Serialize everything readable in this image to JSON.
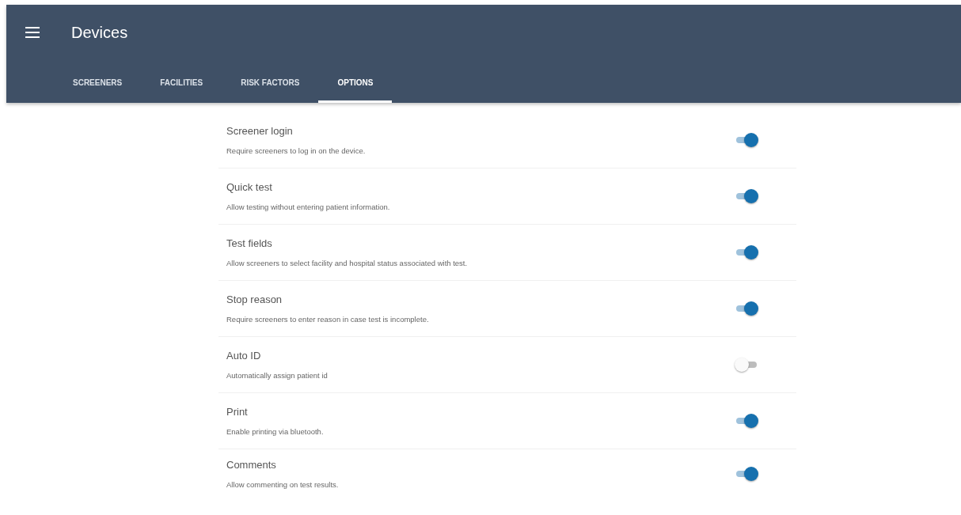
{
  "app_bar": {
    "title": "Devices"
  },
  "tabs": [
    {
      "label": "SCREENERS",
      "selected": false
    },
    {
      "label": "FACILITIES",
      "selected": false
    },
    {
      "label": "RISK FACTORS",
      "selected": false
    },
    {
      "label": "OPTIONS",
      "selected": true
    }
  ],
  "options": [
    {
      "title": "Screener login",
      "description": "Require screeners to log in on the device.",
      "on": true
    },
    {
      "title": "Quick test",
      "description": "Allow testing without entering patient information.",
      "on": true
    },
    {
      "title": "Test fields",
      "description": "Allow screeners to select facility and hospital status associated with test.",
      "on": true
    },
    {
      "title": "Stop reason",
      "description": "Require screeners to enter reason in case test is incomplete.",
      "on": true
    },
    {
      "title": "Auto ID",
      "description": "Automatically assign patient id",
      "on": false
    },
    {
      "title": "Print",
      "description": "Enable printing via bluetooth.",
      "on": true
    },
    {
      "title": "Comments",
      "description": "Allow commenting on test results.",
      "on": true
    }
  ]
}
